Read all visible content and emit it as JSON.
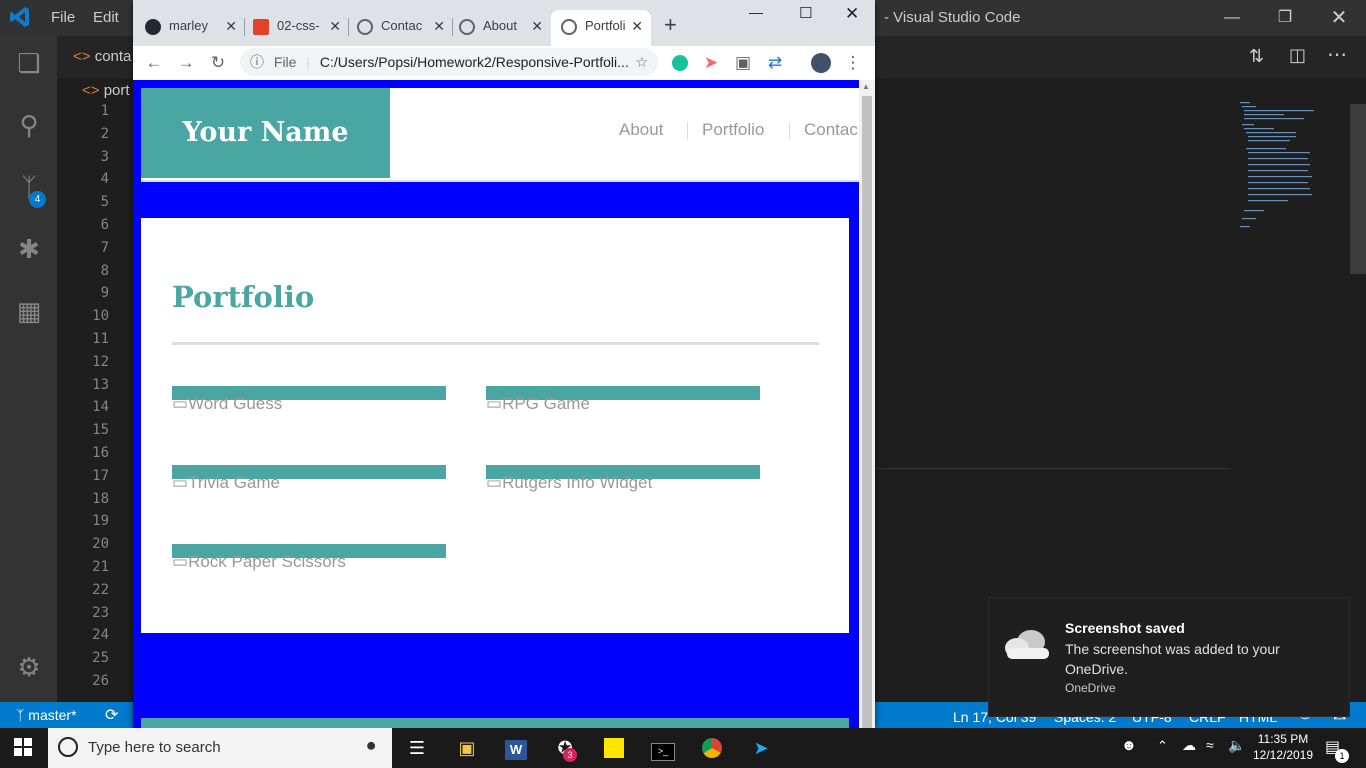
{
  "vscode": {
    "menu": [
      "File",
      "Edit"
    ],
    "title": "- Visual Studio Code",
    "tabs": [
      "conta",
      "port"
    ],
    "line_numbers": [
      "1",
      "2",
      "3",
      "4",
      "5",
      "6",
      "7",
      "8",
      "9",
      "10",
      "11",
      "12",
      "13",
      "14",
      "15",
      "16",
      "17",
      "18",
      "19",
      "20",
      "21",
      "22",
      "23",
      "24",
      "25",
      "26"
    ],
    "scm_badge": "4",
    "status": {
      "branch": "master*",
      "position": "Ln 17, Col 39",
      "spaces": "Spaces: 2",
      "encoding": "UTF-8",
      "eol": "CRLF",
      "language": "HTML"
    }
  },
  "chrome": {
    "tabs": [
      {
        "label": "marley",
        "icon": "github-icon"
      },
      {
        "label": "02-css-",
        "icon": "gitlab-icon"
      },
      {
        "label": "Contac",
        "icon": "globe-icon"
      },
      {
        "label": "About",
        "icon": "globe-icon"
      },
      {
        "label": "Portfoli",
        "icon": "globe-icon",
        "active": true
      }
    ],
    "new_tab": "+",
    "address": {
      "scheme": "File",
      "url": "C:/Users/Popsi/Homework2/Responsive-Portfoli..."
    }
  },
  "site": {
    "logo": "Your Name",
    "nav": [
      "About",
      "Portfolio",
      "Contac"
    ],
    "portfolio_title": "Portfolio",
    "projects": [
      "Word Guess",
      "RPG Game",
      "Trivia Game",
      "Rutgers Info Widget",
      "Rock Paper Scissors"
    ],
    "colors": {
      "teal": "#4aa6a3",
      "background": "#0000ff"
    }
  },
  "toast": {
    "title": "Screenshot saved",
    "message": "The screenshot was added to your OneDrive.",
    "source": "OneDrive"
  },
  "taskbar": {
    "search_placeholder": "Type here to search",
    "time": "11:35 PM",
    "date": "12/12/2019",
    "notification_count": "1",
    "slack_badge": "3"
  }
}
